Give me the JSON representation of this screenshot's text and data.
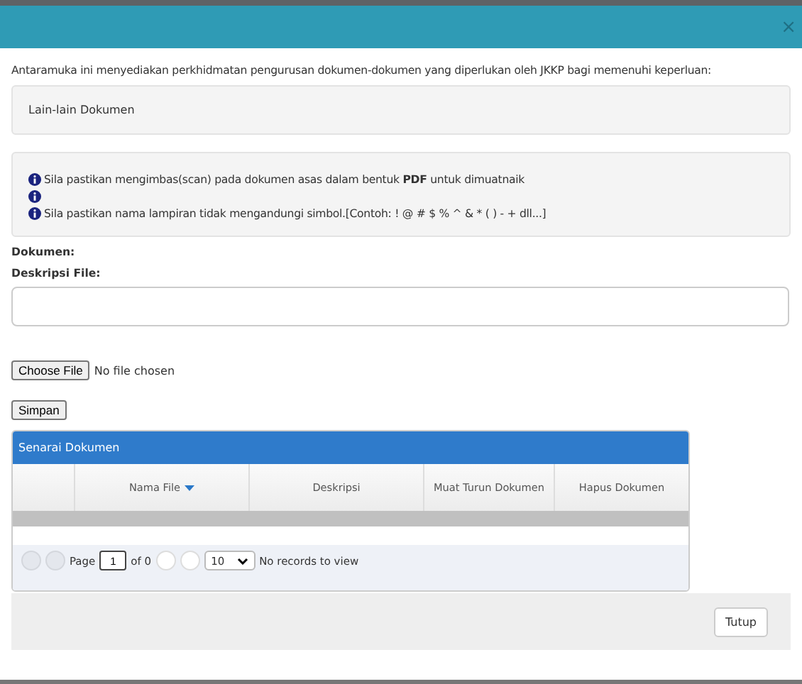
{
  "dialog": {
    "close": "×",
    "intro": "Antaramuka ini menyediakan perkhidmatan pengurusan dokumen-dokumen yang diperlukan oleh JKKP bagi memenuhi keperluan:",
    "category": "Lain-lain Dokumen",
    "notes": [
      {
        "kind": "info",
        "text": "Sila pastikan mengimbas(scan) pada dokumen asas dalam bentuk **PDF** untuk dimuatnaik"
      },
      {
        "kind": "info"
      },
      {
        "kind": "info",
        "text": "Sila pastikan nama lampiran tidak mengandungi simbol.[Contoh: ! @ # $ % ^ & * ( ) - + dll...]"
      }
    ],
    "document_label": "Dokumen:",
    "description_label": "Deskripsi File:",
    "file_button": "Choose File",
    "file_status": "No file chosen",
    "save_button": "Simpan",
    "grid": {
      "title": "Senarai Dokumen",
      "columns": [
        {
          "sorted": false
        },
        {
          "label": "Nama File",
          "sorted": true
        },
        {
          "label": "Deskripsi",
          "sorted": false
        },
        {
          "label": "Muat Turun Dokumen",
          "sorted": false
        },
        {
          "label": "Hapus Dokumen",
          "sorted": false
        }
      ],
      "pager": {
        "buttons_before": [
          {
            "disabled": true
          },
          {
            "disabled": true
          }
        ],
        "page_label": "Page",
        "page": "1",
        "of": "of 0",
        "buttons_after": [
          {
            "disabled": false
          },
          {
            "disabled": false
          }
        ],
        "page_size": "10",
        "status": "No records to view"
      }
    },
    "close_button": "Tutup"
  }
}
